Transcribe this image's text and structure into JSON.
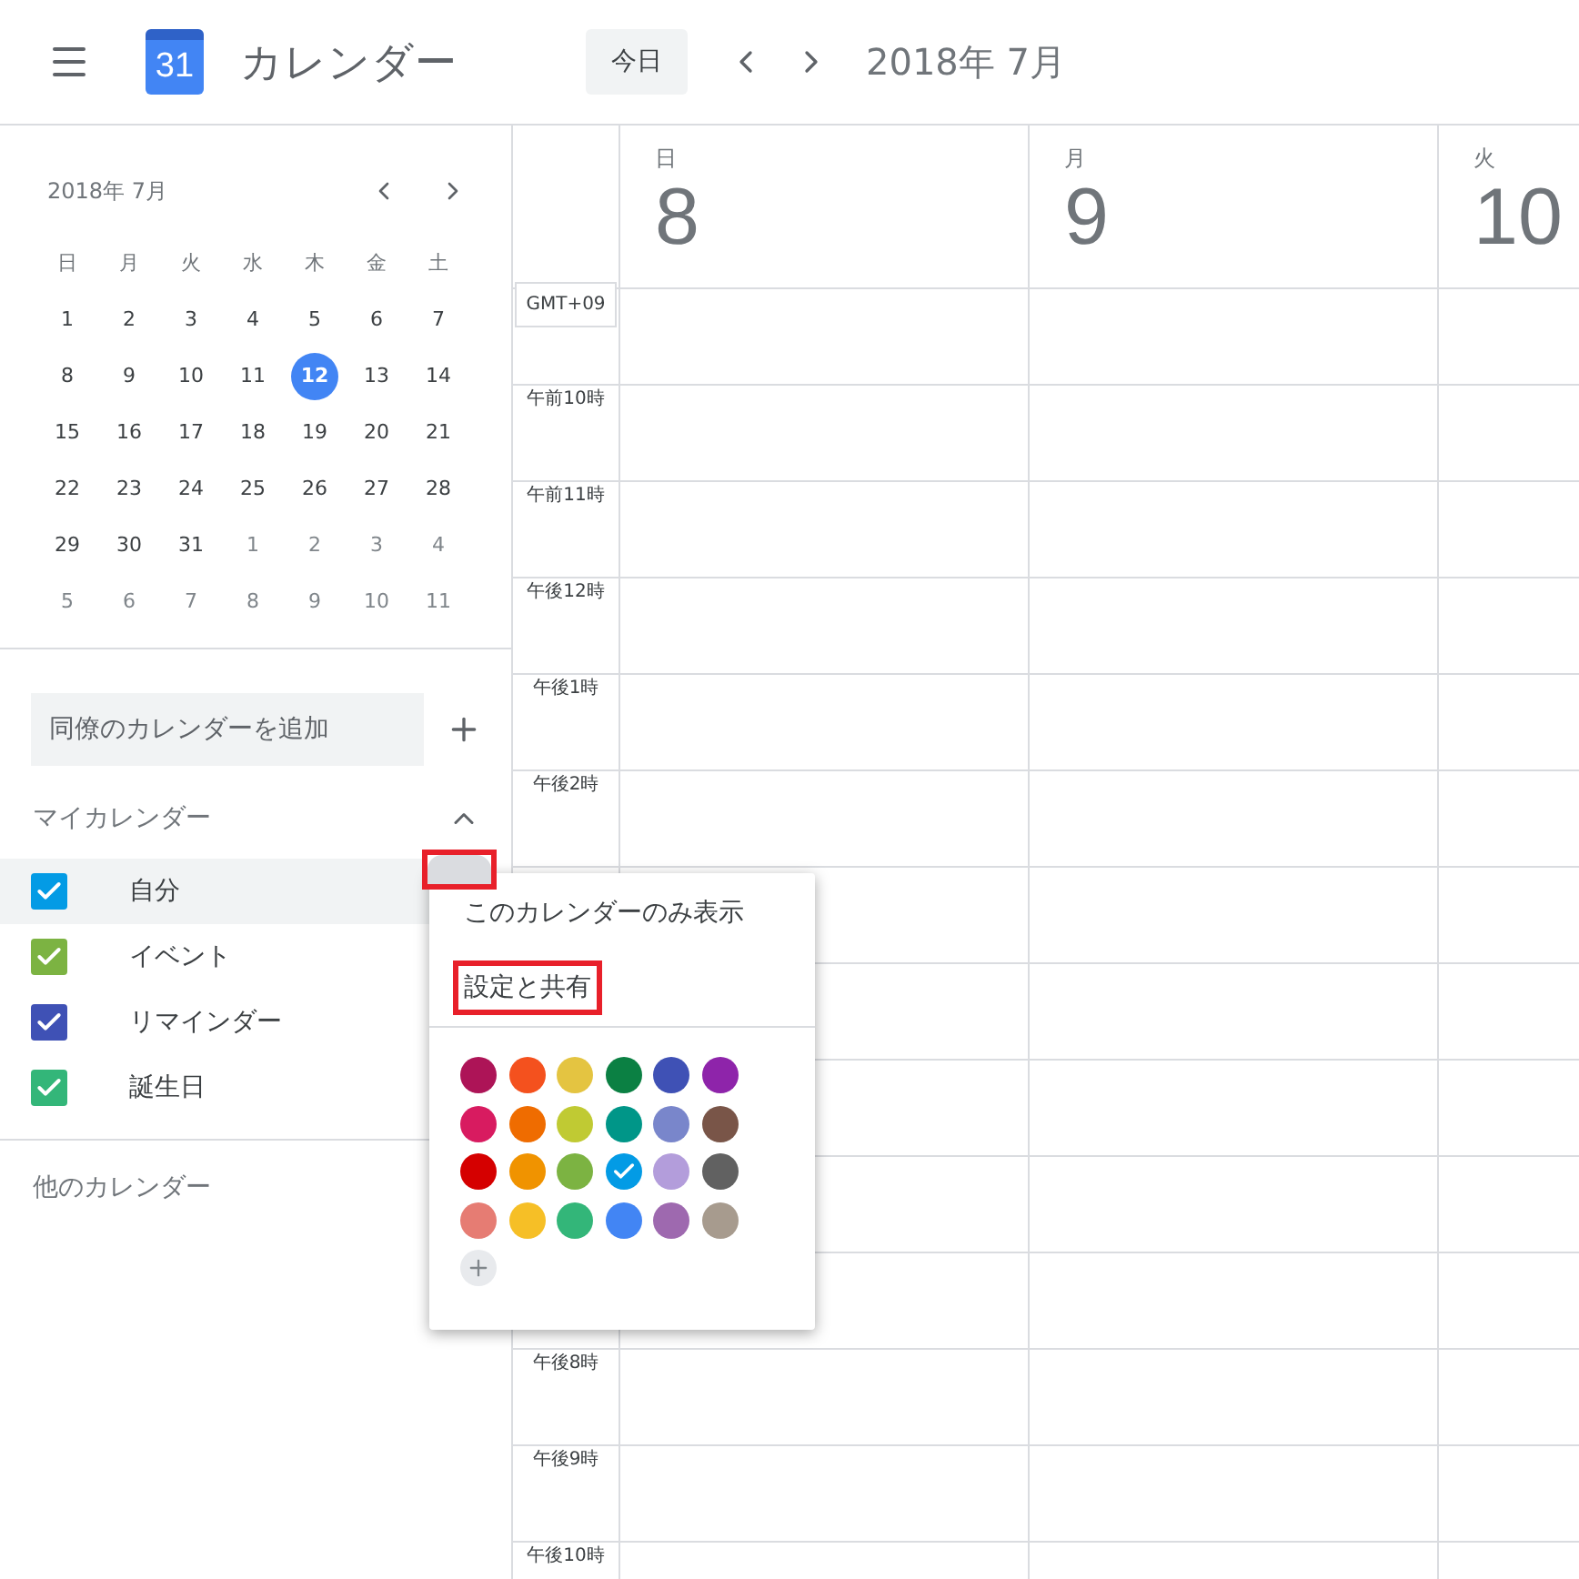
{
  "header": {
    "app_title": "カレンダー",
    "logo_text": "31",
    "today_button": "今日",
    "period": "2018年 7月"
  },
  "mini_calendar": {
    "title": "2018年 7月",
    "weekdays": [
      "日",
      "月",
      "火",
      "水",
      "木",
      "金",
      "土"
    ],
    "weeks": [
      [
        {
          "label": "1",
          "outside": false,
          "selected": false
        },
        {
          "label": "2",
          "outside": false,
          "selected": false
        },
        {
          "label": "3",
          "outside": false,
          "selected": false
        },
        {
          "label": "4",
          "outside": false,
          "selected": false
        },
        {
          "label": "5",
          "outside": false,
          "selected": false
        },
        {
          "label": "6",
          "outside": false,
          "selected": false
        },
        {
          "label": "7",
          "outside": false,
          "selected": false
        }
      ],
      [
        {
          "label": "8",
          "outside": false,
          "selected": false
        },
        {
          "label": "9",
          "outside": false,
          "selected": false
        },
        {
          "label": "10",
          "outside": false,
          "selected": false
        },
        {
          "label": "11",
          "outside": false,
          "selected": false
        },
        {
          "label": "12",
          "outside": false,
          "selected": true
        },
        {
          "label": "13",
          "outside": false,
          "selected": false
        },
        {
          "label": "14",
          "outside": false,
          "selected": false
        }
      ],
      [
        {
          "label": "15",
          "outside": false,
          "selected": false
        },
        {
          "label": "16",
          "outside": false,
          "selected": false
        },
        {
          "label": "17",
          "outside": false,
          "selected": false
        },
        {
          "label": "18",
          "outside": false,
          "selected": false
        },
        {
          "label": "19",
          "outside": false,
          "selected": false
        },
        {
          "label": "20",
          "outside": false,
          "selected": false
        },
        {
          "label": "21",
          "outside": false,
          "selected": false
        }
      ],
      [
        {
          "label": "22",
          "outside": false,
          "selected": false
        },
        {
          "label": "23",
          "outside": false,
          "selected": false
        },
        {
          "label": "24",
          "outside": false,
          "selected": false
        },
        {
          "label": "25",
          "outside": false,
          "selected": false
        },
        {
          "label": "26",
          "outside": false,
          "selected": false
        },
        {
          "label": "27",
          "outside": false,
          "selected": false
        },
        {
          "label": "28",
          "outside": false,
          "selected": false
        }
      ],
      [
        {
          "label": "29",
          "outside": false,
          "selected": false
        },
        {
          "label": "30",
          "outside": false,
          "selected": false
        },
        {
          "label": "31",
          "outside": false,
          "selected": false
        },
        {
          "label": "1",
          "outside": true,
          "selected": false
        },
        {
          "label": "2",
          "outside": true,
          "selected": false
        },
        {
          "label": "3",
          "outside": true,
          "selected": false
        },
        {
          "label": "4",
          "outside": true,
          "selected": false
        }
      ],
      [
        {
          "label": "5",
          "outside": true,
          "selected": false
        },
        {
          "label": "6",
          "outside": true,
          "selected": false
        },
        {
          "label": "7",
          "outside": true,
          "selected": false
        },
        {
          "label": "8",
          "outside": true,
          "selected": false
        },
        {
          "label": "9",
          "outside": true,
          "selected": false
        },
        {
          "label": "10",
          "outside": true,
          "selected": false
        },
        {
          "label": "11",
          "outside": true,
          "selected": false
        }
      ]
    ]
  },
  "add_calendar": {
    "placeholder": "同僚のカレンダーを追加"
  },
  "my_calendars": {
    "title": "マイカレンダー",
    "expanded": true,
    "items": [
      {
        "label": "自分",
        "color": "#039be5",
        "checked": true,
        "hovered": true,
        "options_highlighted": true
      },
      {
        "label": "イベント",
        "color": "#7cb342",
        "checked": true,
        "hovered": false
      },
      {
        "label": "リマインダー",
        "color": "#3f51b5",
        "checked": true,
        "hovered": false
      },
      {
        "label": "誕生日",
        "color": "#33b679",
        "checked": true,
        "hovered": false
      }
    ]
  },
  "other_calendars": {
    "title": "他のカレンダー"
  },
  "week_view": {
    "timezone": "GMT+09",
    "days": [
      {
        "weekday": "日",
        "date": "8"
      },
      {
        "weekday": "月",
        "date": "9"
      },
      {
        "weekday": "火",
        "date": "10"
      }
    ],
    "hours_above_menu": [
      "午前10時",
      "午前11時",
      "午後12時",
      "午後1時",
      "午後2時"
    ],
    "hours_below_menu": [
      "午後8時",
      "午後9時",
      "午後10時"
    ]
  },
  "popup_menu": {
    "items": [
      {
        "label": "このカレンダーのみ表示",
        "highlighted": false
      },
      {
        "label": "設定と共有",
        "highlighted": true
      }
    ],
    "swatches": [
      {
        "color": "#ad1457",
        "selected": false
      },
      {
        "color": "#f4511e",
        "selected": false
      },
      {
        "color": "#e4c441",
        "selected": false
      },
      {
        "color": "#0b8043",
        "selected": false
      },
      {
        "color": "#3f51b5",
        "selected": false
      },
      {
        "color": "#8e24aa",
        "selected": false
      },
      {
        "color": "#d81b60",
        "selected": false
      },
      {
        "color": "#ef6c00",
        "selected": false
      },
      {
        "color": "#c0ca33",
        "selected": false
      },
      {
        "color": "#009688",
        "selected": false
      },
      {
        "color": "#7986cb",
        "selected": false
      },
      {
        "color": "#795548",
        "selected": false
      },
      {
        "color": "#d50000",
        "selected": false
      },
      {
        "color": "#f09300",
        "selected": false
      },
      {
        "color": "#7cb342",
        "selected": false
      },
      {
        "color": "#039be5",
        "selected": true
      },
      {
        "color": "#b39ddb",
        "selected": false
      },
      {
        "color": "#616161",
        "selected": false
      },
      {
        "color": "#e67c73",
        "selected": false
      },
      {
        "color": "#f6bf26",
        "selected": false
      },
      {
        "color": "#33b679",
        "selected": false
      },
      {
        "color": "#4285f4",
        "selected": false
      },
      {
        "color": "#9e69af",
        "selected": false
      },
      {
        "color": "#a79b8e",
        "selected": false
      }
    ]
  }
}
